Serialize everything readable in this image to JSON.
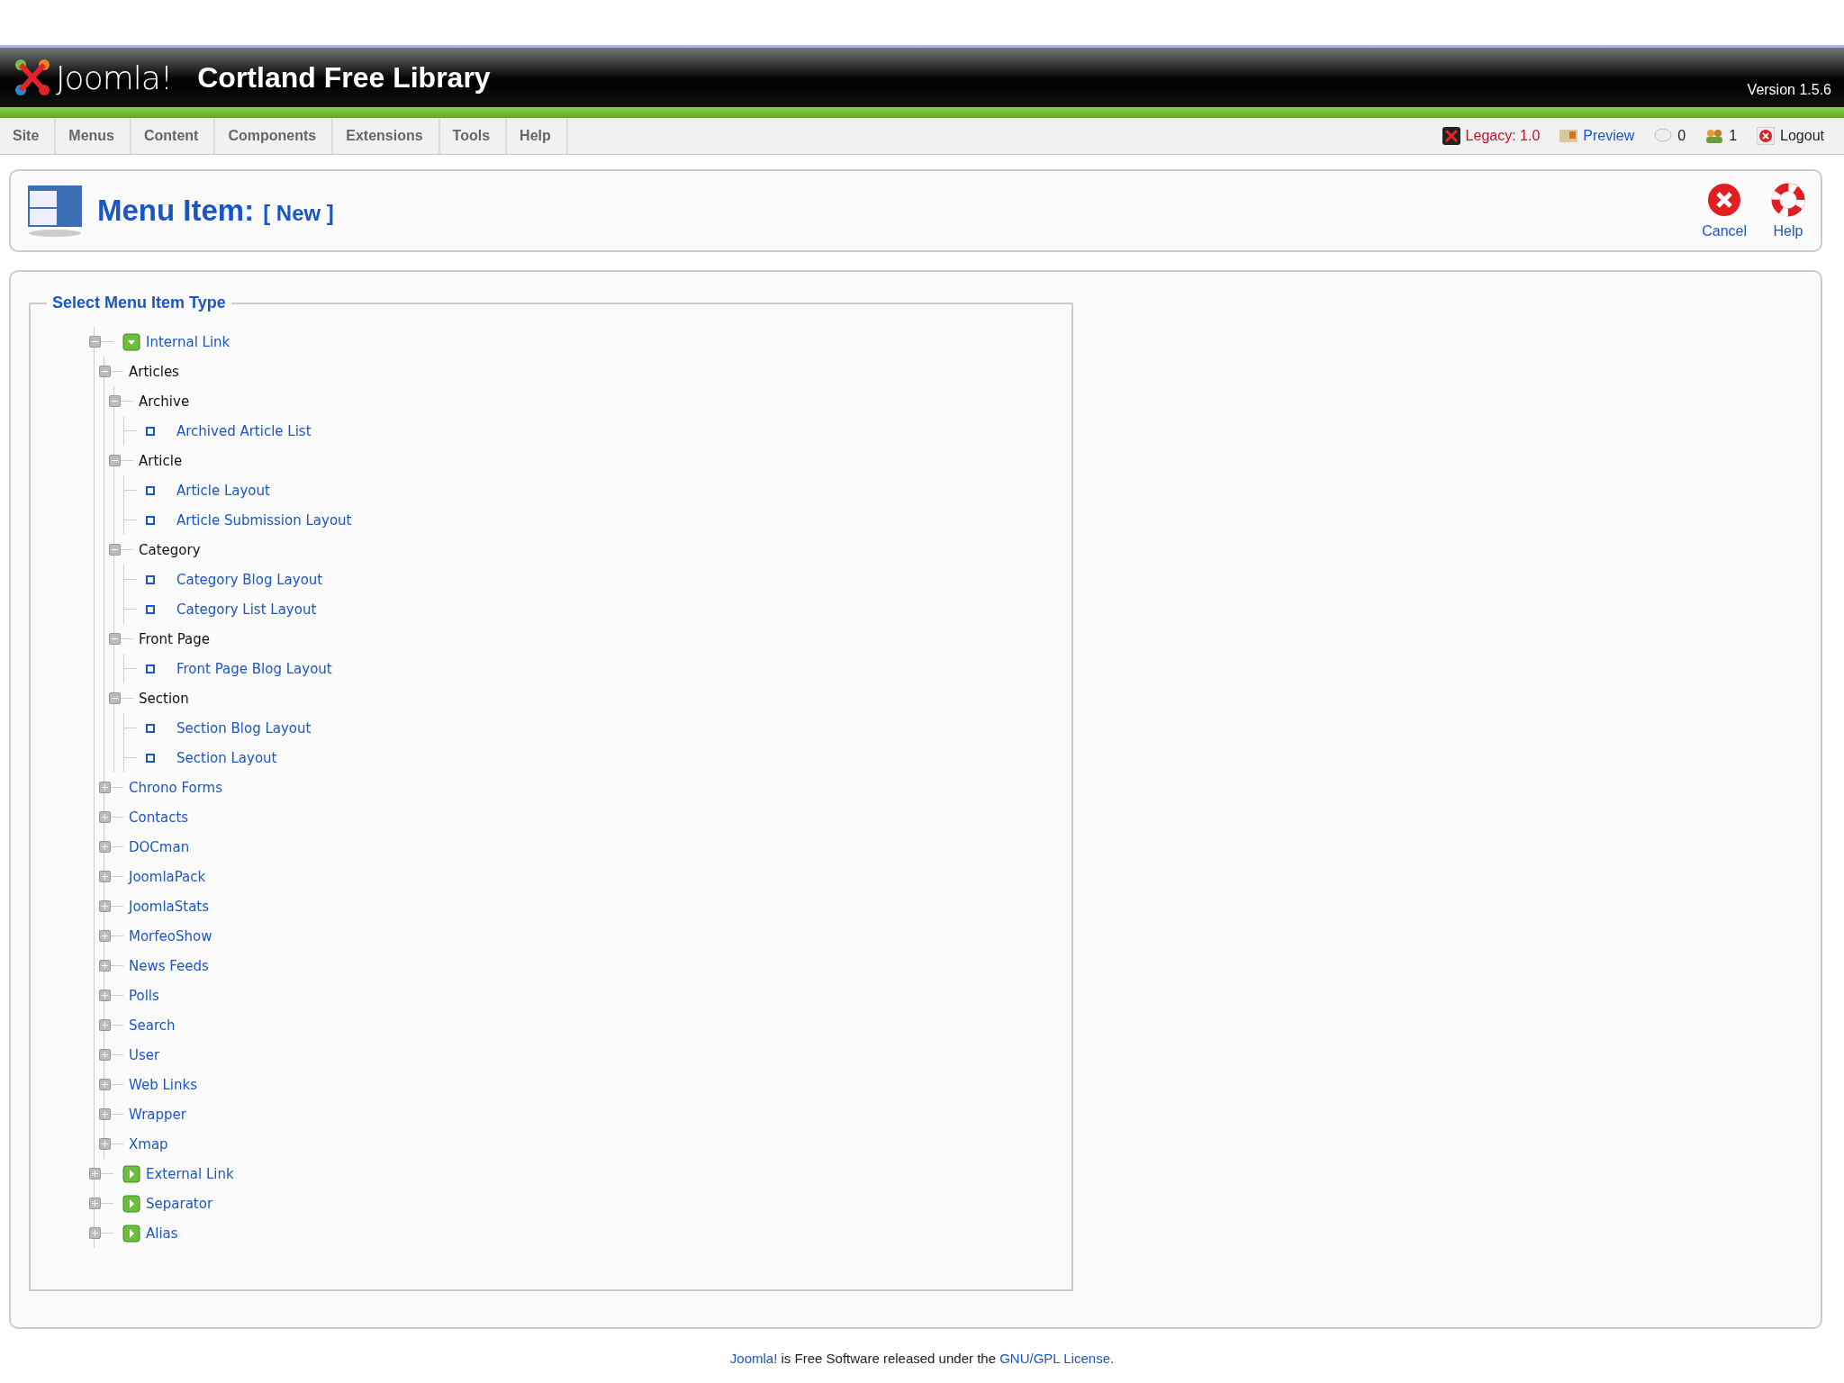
{
  "header": {
    "logo_text": "Joomla!",
    "site_name": "Cortland Free Library",
    "version": "Version 1.5.6"
  },
  "menu": [
    {
      "label": "Site"
    },
    {
      "label": "Menus"
    },
    {
      "label": "Content"
    },
    {
      "label": "Components"
    },
    {
      "label": "Extensions"
    },
    {
      "label": "Tools"
    },
    {
      "label": "Help"
    }
  ],
  "status": [
    {
      "kind": "legacy",
      "label": "Legacy: 1.0"
    },
    {
      "kind": "preview",
      "label": "Preview"
    },
    {
      "kind": "messages",
      "label": "0"
    },
    {
      "kind": "users",
      "label": "1"
    },
    {
      "kind": "logout",
      "label": "Logout"
    }
  ],
  "toolbar": {
    "title": "Menu Item:",
    "subtitle": "[ New ]",
    "buttons": [
      {
        "kind": "cancel",
        "label": "Cancel"
      },
      {
        "kind": "help",
        "label": "Help"
      }
    ]
  },
  "fieldset": {
    "legend": "Select Menu Item Type"
  },
  "tree": [
    {
      "kind": "type",
      "label": "Internal Link",
      "expanded": true,
      "children": [
        {
          "kind": "group",
          "label": "Articles",
          "expanded": true,
          "children": [
            {
              "kind": "group",
              "label": "Archive",
              "expanded": true,
              "children": [
                {
                  "kind": "leaf",
                  "label": "Archived Article List"
                }
              ]
            },
            {
              "kind": "group",
              "label": "Article",
              "expanded": true,
              "children": [
                {
                  "kind": "leaf",
                  "label": "Article Layout"
                },
                {
                  "kind": "leaf",
                  "label": "Article Submission Layout"
                }
              ]
            },
            {
              "kind": "group",
              "label": "Category",
              "expanded": true,
              "children": [
                {
                  "kind": "leaf",
                  "label": "Category Blog Layout"
                },
                {
                  "kind": "leaf",
                  "label": "Category List Layout"
                }
              ]
            },
            {
              "kind": "group",
              "label": "Front Page",
              "expanded": true,
              "children": [
                {
                  "kind": "leaf",
                  "label": "Front Page Blog Layout"
                }
              ]
            },
            {
              "kind": "group",
              "label": "Section",
              "expanded": true,
              "children": [
                {
                  "kind": "leaf",
                  "label": "Section Blog Layout"
                },
                {
                  "kind": "leaf",
                  "label": "Section Layout"
                }
              ]
            }
          ]
        },
        {
          "kind": "component",
          "label": "Chrono Forms",
          "expanded": false
        },
        {
          "kind": "component",
          "label": "Contacts",
          "expanded": false
        },
        {
          "kind": "component",
          "label": "DOCman",
          "expanded": false
        },
        {
          "kind": "component",
          "label": "JoomlaPack",
          "expanded": false
        },
        {
          "kind": "component",
          "label": "JoomlaStats",
          "expanded": false
        },
        {
          "kind": "component",
          "label": "MorfeoShow",
          "expanded": false
        },
        {
          "kind": "component",
          "label": "News Feeds",
          "expanded": false
        },
        {
          "kind": "component",
          "label": "Polls",
          "expanded": false
        },
        {
          "kind": "component",
          "label": "Search",
          "expanded": false
        },
        {
          "kind": "component",
          "label": "User",
          "expanded": false
        },
        {
          "kind": "component",
          "label": "Web Links",
          "expanded": false
        },
        {
          "kind": "component",
          "label": "Wrapper",
          "expanded": false
        },
        {
          "kind": "component",
          "label": "Xmap",
          "expanded": false
        }
      ]
    },
    {
      "kind": "type",
      "label": "External Link",
      "expanded": false
    },
    {
      "kind": "type",
      "label": "Separator",
      "expanded": false
    },
    {
      "kind": "type",
      "label": "Alias",
      "expanded": false
    }
  ],
  "footer": {
    "link1": "Joomla!",
    "text": "is Free Software released under the",
    "link2": "GNU/GPL License",
    "end": "."
  }
}
